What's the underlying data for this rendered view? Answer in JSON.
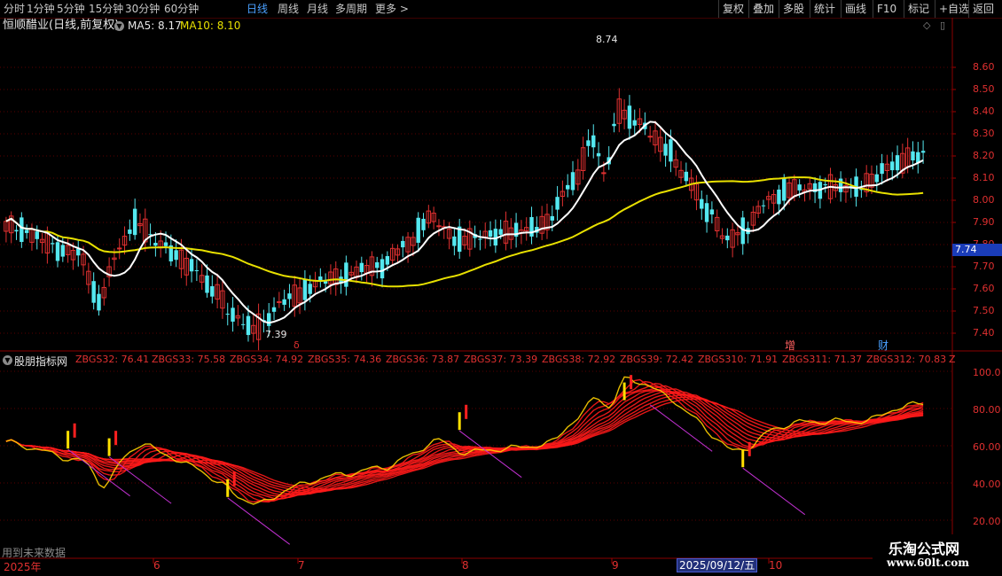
{
  "toolbar": {
    "periods": [
      "分时",
      "1分钟",
      "5分钟",
      "15分钟",
      "30分钟",
      "60分钟",
      "日线",
      "周线",
      "月线",
      "多周期",
      "更多 >"
    ],
    "active_period": "日线",
    "right": [
      "复权",
      "叠加",
      "多股",
      "统计",
      "画线",
      "F10",
      "标记",
      "+自选",
      "返回"
    ]
  },
  "header": {
    "stock_name": "恒顺醋业(日线,前复权)",
    "ma5_label": "MA5: 8.17",
    "ma10_label": "MA10: 8.10"
  },
  "price_axis": {
    "ticks": [
      "8.60",
      "8.50",
      "8.40",
      "8.30",
      "8.20",
      "8.10",
      "8.00",
      "7.90",
      "7.80",
      "7.70",
      "7.60",
      "7.50",
      "7.40"
    ],
    "current_price": "7.74"
  },
  "annotations": {
    "high": "8.74",
    "low": "7.39",
    "marker_left": "δ",
    "marker_zeng": "增",
    "marker_cai": "财"
  },
  "indicator": {
    "title": "股朋指标网",
    "values": [
      "ZBGS32: 76.41",
      "ZBGS33: 75.58",
      "ZBGS34: 74.92",
      "ZBGS35: 74.36",
      "ZBGS36: 73.87",
      "ZBGS37: 73.39",
      "ZBGS38: 72.92",
      "ZBGS39: 72.42",
      "ZBGS310: 71.91",
      "ZBGS311: 71.37",
      "ZBGS312: 70.83",
      "Z"
    ],
    "ticks": [
      "100.0",
      "80.00",
      "60.00",
      "40.00",
      "20.00"
    ]
  },
  "footer": {
    "future_note": "用到未来数据",
    "dates": [
      "2025年",
      "6",
      "7",
      "8",
      "9",
      "10"
    ],
    "selected_date": "2025/09/12/五"
  },
  "watermark": {
    "name": "乐淘公式网",
    "url": "www.60lt.com"
  },
  "colors": {
    "up": "#e03030",
    "down": "#54e8f0",
    "ma5": "#ffffff",
    "ma10": "#e8e000",
    "grid": "#5a0000",
    "accent": "#4aa0ff"
  }
}
